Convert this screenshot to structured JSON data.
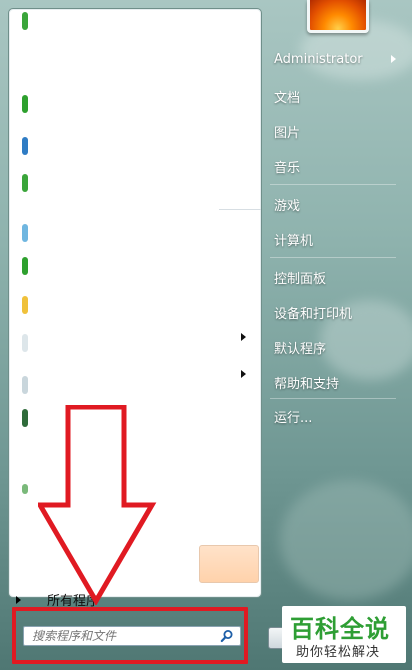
{
  "start_menu": {
    "all_programs_label": "所有程序",
    "search_placeholder": "搜索程序和文件"
  },
  "right_panel": {
    "items": [
      {
        "label": "Administrator",
        "has_arrow": true
      },
      {
        "label": "文档"
      },
      {
        "label": "图片"
      },
      {
        "label": "音乐"
      },
      {
        "label": "游戏"
      },
      {
        "label": "计算机"
      },
      {
        "label": "控制面板"
      },
      {
        "label": "设备和打印机"
      },
      {
        "label": "默认程序"
      },
      {
        "label": "帮助和支持"
      },
      {
        "label": "运行..."
      }
    ]
  },
  "watermark": {
    "main": "百科全说",
    "sub": "助你轻松解决"
  },
  "colors": {
    "annotation_red": "#e01a22",
    "watermark_green": "#2e9e34"
  },
  "icons": {
    "search": "magnifier-icon",
    "user": "flower-avatar-icon"
  }
}
